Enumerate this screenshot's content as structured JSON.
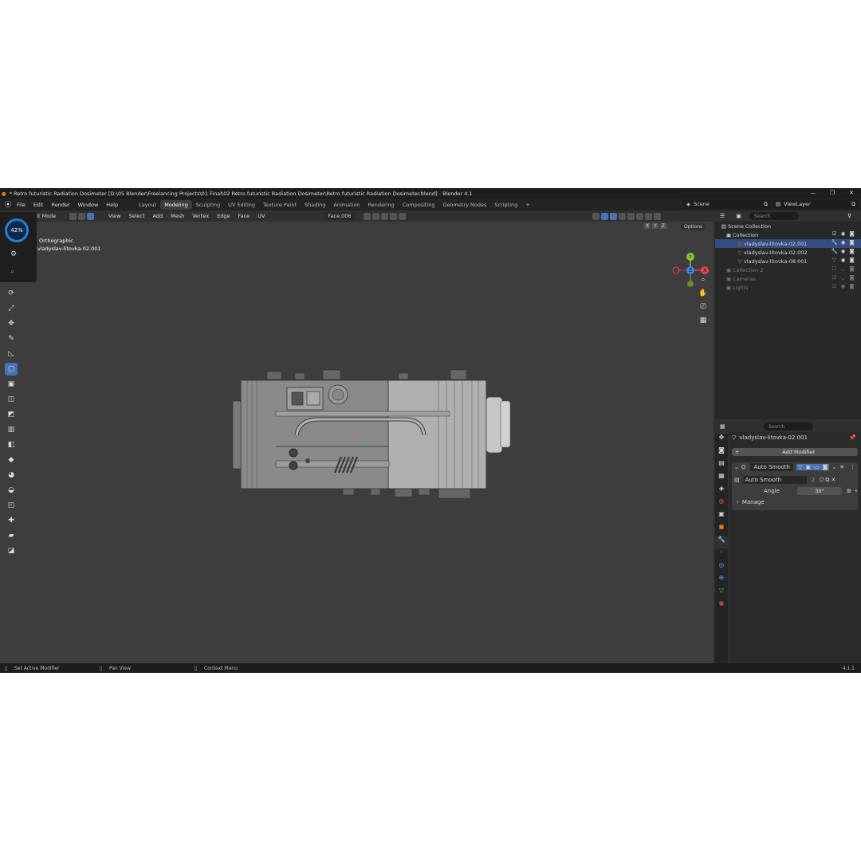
{
  "window": {
    "title": "* Retro futuristic Radiation Dosimeter [D:\\05 Blender\\Freelancing Projects\\01 Final\\02 Retro futuristic Radiation Dosimeter\\Retro futuristic Radiation Dosimeter.blend] - Blender 4.1",
    "minimize": "—",
    "maximize": "❐",
    "close": "✕"
  },
  "menu": {
    "logo": "⦿",
    "items": [
      "File",
      "Edit",
      "Render",
      "Window",
      "Help"
    ]
  },
  "workspaces": [
    "Layout",
    "Modeling",
    "Sculpting",
    "UV Editing",
    "Texture Paint",
    "Shading",
    "Animation",
    "Rendering",
    "Compositing",
    "Geometry Nodes",
    "Scripting"
  ],
  "active_workspace": "Modeling",
  "add_workspace": "+",
  "scene": {
    "label": "Scene"
  },
  "view_layer": {
    "label": "ViewLayer"
  },
  "viewport_header": {
    "mode": "Edit Mode",
    "menus": [
      "View",
      "Select",
      "Add",
      "Mesh",
      "Vertex",
      "Edge",
      "Face",
      "UV"
    ],
    "transform_orientation": "Face.006",
    "options": "Options",
    "axes": [
      "X",
      "Y",
      "Z"
    ]
  },
  "viewport": {
    "view_name": "Orthographic",
    "object_name": "vladyslav-litovka-02.001"
  },
  "perf_widget": {
    "percent": "42%"
  },
  "gizmo": {
    "x": "X",
    "y": "Y",
    "z": "Z"
  },
  "outliner": {
    "search_placeholder": "Search",
    "rows": [
      {
        "label": "Scene Collection",
        "dim": false
      },
      {
        "label": "Collection",
        "dim": false
      },
      {
        "label": "vladyslav-litovka-02.001",
        "dim": false,
        "selected": true
      },
      {
        "label": "vladyslav-litovka-02.002",
        "dim": false
      },
      {
        "label": "vladyslav-litovka-08.001",
        "dim": false
      },
      {
        "label": "Collection 2",
        "dim": true
      },
      {
        "label": "Cameras",
        "dim": true
      },
      {
        "label": "Lights",
        "dim": true
      }
    ]
  },
  "properties": {
    "search_placeholder": "Search",
    "object_name": "vladyslav-litovka-02.001",
    "add_modifier": "Add Modifier",
    "modifier_name": "Auto Smooth",
    "node_group": "Auto Smooth",
    "node_users": "2",
    "angle_label": "Angle",
    "angle_value": "30°",
    "manage": "Manage"
  },
  "status": {
    "left": "Set Active Modifier",
    "middle": "Pan View",
    "right": "Context Menu",
    "version": "4.1.1"
  },
  "colors": {
    "accent": "#4772b3",
    "selection": "#334d80",
    "axis_x": "#e54550",
    "axis_y": "#8ac43b",
    "axis_z": "#3d86e6"
  }
}
